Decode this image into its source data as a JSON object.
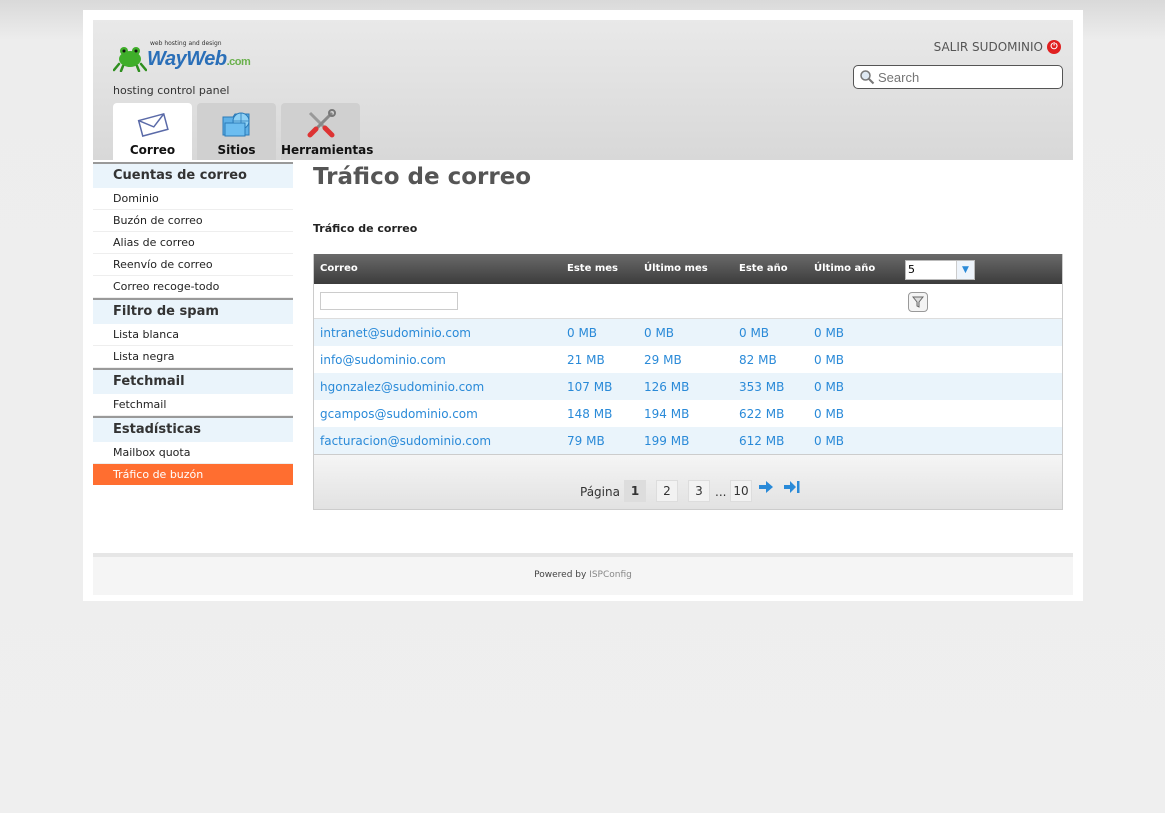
{
  "header": {
    "logo_tagline": "web hosting and design",
    "logo_brand": "WayWeb",
    "logo_tld": ".com",
    "subtitle": "hosting control panel",
    "logout_label": "SALIR SUDOMINIO",
    "search_placeholder": "Search"
  },
  "tabs": [
    {
      "label": "Correo",
      "icon": "envelope-icon",
      "active": true
    },
    {
      "label": "Sitios",
      "icon": "folder-globe-icon",
      "active": false
    },
    {
      "label": "Herramientas",
      "icon": "tools-icon",
      "active": false
    }
  ],
  "sidebar": {
    "sections": [
      {
        "title": "Cuentas de correo",
        "items": [
          "Dominio",
          "Buzón de correo",
          "Alias de correo",
          "Reenvío de correo",
          "Correo recoge-todo"
        ]
      },
      {
        "title": "Filtro de spam",
        "items": [
          "Lista blanca",
          "Lista negra"
        ]
      },
      {
        "title": "Fetchmail",
        "items": [
          "Fetchmail"
        ]
      },
      {
        "title": "Estadísticas",
        "items": [
          "Mailbox quota",
          "Tráfico de buzón"
        ]
      }
    ],
    "active_item": "Tráfico de buzón"
  },
  "main": {
    "title": "Tráfico de correo",
    "subtitle": "Tráfico de correo"
  },
  "table": {
    "columns": [
      "Correo",
      "Este mes",
      "Último mes",
      "Este año",
      "Último año"
    ],
    "page_size": "5",
    "rows": [
      [
        "intranet@sudominio.com",
        "0 MB",
        "0 MB",
        "0 MB",
        "0 MB"
      ],
      [
        "info@sudominio.com",
        "21 MB",
        "29 MB",
        "82 MB",
        "0 MB"
      ],
      [
        "hgonzalez@sudominio.com",
        "107 MB",
        "126 MB",
        "353 MB",
        "0 MB"
      ],
      [
        "gcampos@sudominio.com",
        "148 MB",
        "194 MB",
        "622 MB",
        "0 MB"
      ],
      [
        "facturacion@sudominio.com",
        "79 MB",
        "199 MB",
        "612 MB",
        "0 MB"
      ]
    ]
  },
  "pager": {
    "label": "Página",
    "pages": [
      "1",
      "2",
      "3",
      "10"
    ],
    "ellipsis": "...",
    "current": "1"
  },
  "footer": {
    "text": "Powered by",
    "link": "ISPConfig"
  },
  "colors": {
    "accent": "#ff6e30",
    "link": "#2a8ad8",
    "section_bg": "#eaf4fb"
  }
}
